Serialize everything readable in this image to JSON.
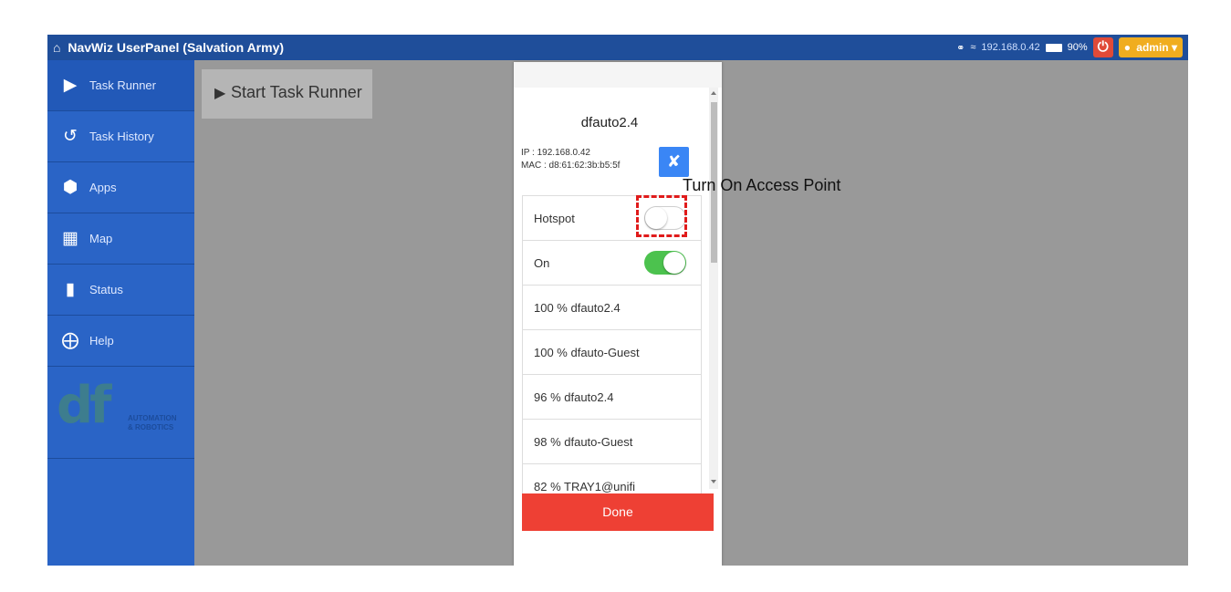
{
  "header": {
    "title": "NavWiz UserPanel",
    "subtitle": "(Salvation Army)",
    "home_icon": "home-icon",
    "ip": "192.168.0.42",
    "battery": "90%",
    "user": "admin"
  },
  "sidebar": {
    "items": [
      {
        "label": "Task Runner",
        "icon": "play-icon"
      },
      {
        "label": "Task History",
        "icon": "history-icon"
      },
      {
        "label": "Apps",
        "icon": "cube-icon"
      },
      {
        "label": "Map",
        "icon": "map-icon"
      },
      {
        "label": "Status",
        "icon": "bar-chart-icon"
      },
      {
        "label": "Help",
        "icon": "lifebuoy-icon"
      }
    ],
    "logo": {
      "mark": "df",
      "line1": "AUTOMATION",
      "line2": "& ROBOTICS"
    }
  },
  "main": {
    "start_button_label": "Start Task Runner"
  },
  "wifi_dialog": {
    "ssid": "dfauto2.4",
    "ip_line": "IP : 192.168.0.42",
    "mac_line": "MAC : d8:61:62:3b:b5:5f",
    "hotspot_label": "Hotspot",
    "hotspot_state": "off",
    "wifi_label": "On",
    "wifi_state": "on",
    "networks": [
      "100 % dfauto2.4",
      "100 % dfauto-Guest",
      "96 % dfauto2.4",
      "98 % dfauto-Guest",
      "82 % TRAY1@unifi"
    ],
    "done_label": "Done"
  },
  "annotation": {
    "text": "Turn On Access Point",
    "highlight_color": "#e01b1b"
  },
  "colors": {
    "topbar": "#1f4e9a",
    "sidebar": "#2a64c6",
    "done": "#ee4034",
    "toggle_on": "#4cc24e",
    "tools": "#3a86f5"
  }
}
